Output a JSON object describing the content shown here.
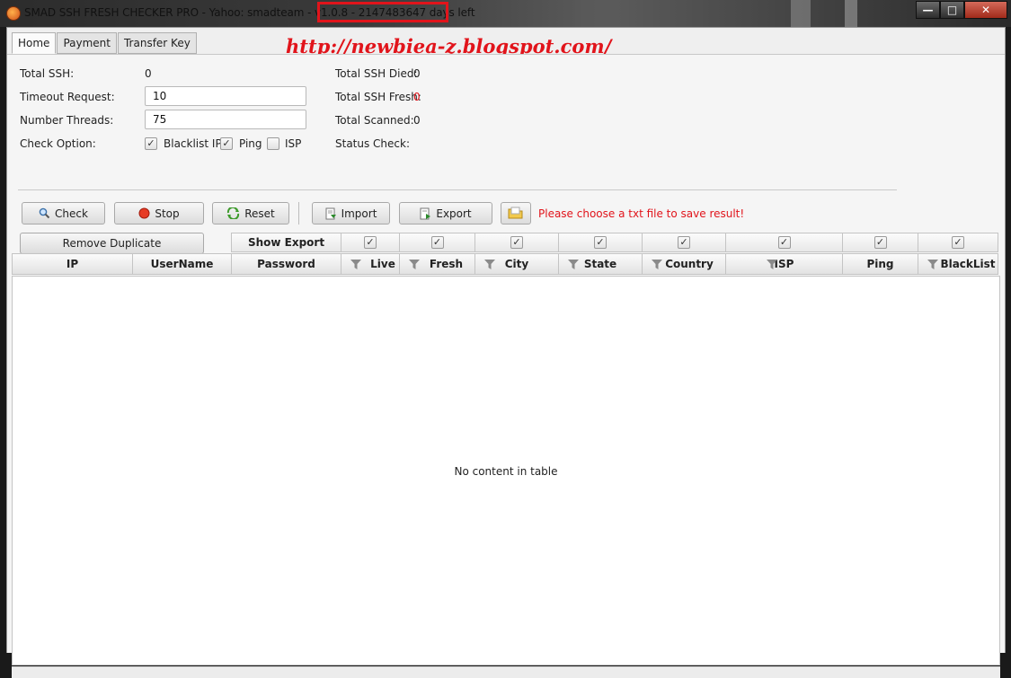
{
  "window": {
    "title": "SMAD SSH FRESH CHECKER PRO - Yahoo: smadteam - v1.0.8 - 2147483647 days left",
    "controls": [
      "minimize",
      "maximize",
      "close"
    ]
  },
  "watermark": "http://newbiea-z.blogspot.com/",
  "tabs": [
    {
      "label": "Home",
      "active": true
    },
    {
      "label": "Payment",
      "active": false
    },
    {
      "label": "Transfer Key",
      "active": false
    }
  ],
  "form": {
    "total_ssh_label": "Total SSH:",
    "total_ssh_value": "0",
    "timeout_label": "Timeout Request:",
    "timeout_value": "10",
    "threads_label": "Number Threads:",
    "threads_value": "75",
    "check_option_label": "Check Option:",
    "options": [
      {
        "label": "Blacklist IP",
        "checked": true
      },
      {
        "label": "Ping",
        "checked": true
      },
      {
        "label": "ISP",
        "checked": false
      }
    ]
  },
  "stats": {
    "died_label": "Total SSH Died:",
    "died_value": "0",
    "fresh_label": "Total SSH Fresh:",
    "fresh_value": "0",
    "scanned_label": "Total Scanned:",
    "scanned_value": "0",
    "status_label": "Status Check:",
    "status_value": ""
  },
  "toolbar": {
    "check": "Check",
    "stop": "Stop",
    "reset": "Reset",
    "import": "Import",
    "export": "Export",
    "warning": "Please choose a txt file to save result!"
  },
  "table": {
    "remove_duplicate": "Remove Duplicate",
    "show_export": "Show Export",
    "export_checks": [
      true,
      true,
      true,
      true,
      true,
      true,
      true,
      true
    ],
    "columns": [
      "IP",
      "UserName",
      "Password",
      "Live",
      "Fresh",
      "City",
      "State",
      "Country",
      "ISP",
      "Ping",
      "BlackList"
    ],
    "empty_text": "No content in table"
  },
  "colors": {
    "accent_red": "#e1141b",
    "panel_bg": "#f5f5f5"
  }
}
